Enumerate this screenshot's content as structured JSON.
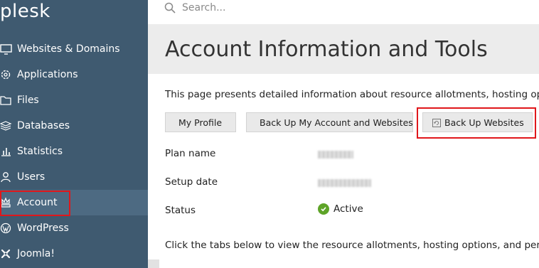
{
  "app": {
    "logo_text": "plesk"
  },
  "sidebar": {
    "items": [
      {
        "label": "Websites & Domains",
        "icon": "monitor-icon"
      },
      {
        "label": "Applications",
        "icon": "gear-icon"
      },
      {
        "label": "Files",
        "icon": "folder-icon"
      },
      {
        "label": "Databases",
        "icon": "database-icon"
      },
      {
        "label": "Statistics",
        "icon": "bar-chart-icon"
      },
      {
        "label": "Users",
        "icon": "user-icon"
      },
      {
        "label": "Account",
        "icon": "account-icon",
        "active": true
      },
      {
        "label": "WordPress",
        "icon": "wordpress-icon"
      },
      {
        "label": "Joomla!",
        "icon": "joomla-icon"
      }
    ]
  },
  "search": {
    "placeholder": "Search..."
  },
  "main": {
    "title": "Account Information and Tools",
    "intro": "This page presents detailed information about resource allotments, hosting optio",
    "buttons": {
      "my_profile": "My Profile",
      "backup_account": "Back Up My Account and Websites",
      "backup_websites": "Back Up Websites"
    },
    "properties": {
      "plan_name_label": "Plan name",
      "setup_date_label": "Setup date",
      "status_label": "Status",
      "status_value": "Active"
    },
    "tabs_note": "Click the tabs below to view the resource allotments, hosting options, and permis"
  },
  "colors": {
    "sidebar_bg": "#3f5a70",
    "sidebar_active_bg": "#4d6a82",
    "highlight_red": "#e0171b",
    "status_green": "#5ea428"
  }
}
